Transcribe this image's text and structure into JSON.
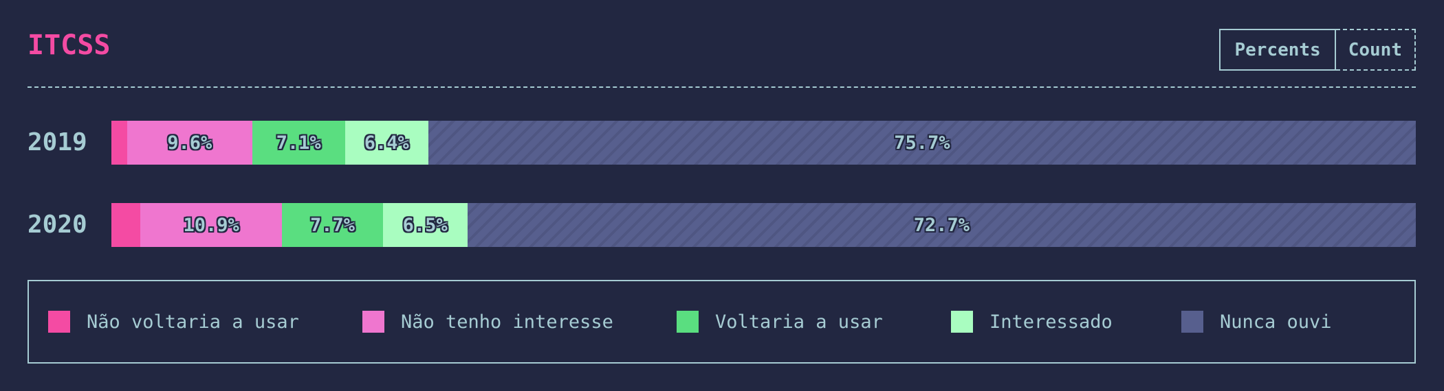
{
  "title": "ITCSS",
  "toggle": {
    "percents_label": "Percents",
    "count_label": "Count"
  },
  "colors": {
    "background": "#222741",
    "text": "#a6ccd3",
    "accent": "#f44ba3"
  },
  "chart_data": {
    "type": "bar",
    "orientation": "horizontal-stacked",
    "categories": [
      "2019",
      "2020"
    ],
    "series": [
      {
        "name": "Não voltaria a usar",
        "color": "#f44ba3",
        "values": [
          1.2,
          2.2
        ],
        "labels": [
          "",
          ""
        ]
      },
      {
        "name": "Não tenho interesse",
        "color": "#ef76cf",
        "values": [
          9.6,
          10.9
        ],
        "labels": [
          "9.6%",
          "10.9%"
        ]
      },
      {
        "name": "Voltaria a usar",
        "color": "#5ade80",
        "values": [
          7.1,
          7.7
        ],
        "labels": [
          "7.1%",
          "7.7%"
        ]
      },
      {
        "name": "Interessado",
        "color": "#a9fdc0",
        "values": [
          6.4,
          6.5
        ],
        "labels": [
          "6.4%",
          "6.5%"
        ]
      },
      {
        "name": "Nunca ouvi",
        "color": "#575f8e",
        "values": [
          75.7,
          72.7
        ],
        "labels": [
          "75.7%",
          "72.7%"
        ]
      }
    ],
    "xlim": [
      0,
      100
    ],
    "legend_position": "bottom",
    "grid": false
  }
}
